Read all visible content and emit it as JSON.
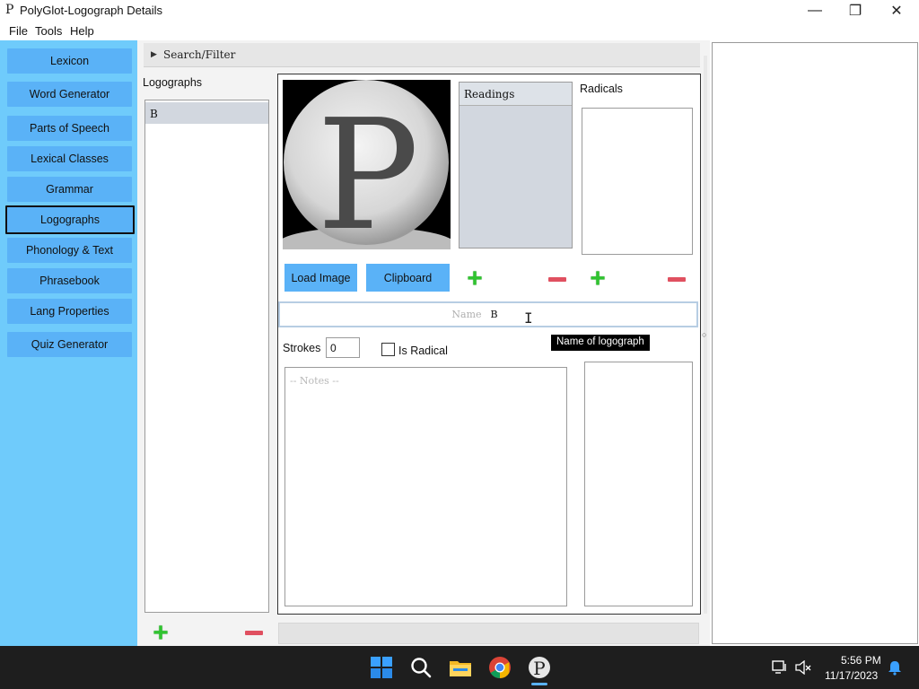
{
  "window": {
    "title": "PolyGlot-Logograph Details",
    "app_icon_glyph": "P",
    "controls": {
      "minimize": "—",
      "maximize": "❐",
      "close": "✕"
    }
  },
  "menu": [
    "File",
    "Tools",
    "Help"
  ],
  "sidebar": {
    "items": [
      {
        "label": "Lexicon"
      },
      {
        "label": "Word Generator"
      },
      {
        "label": "Parts of Speech"
      },
      {
        "label": "Lexical Classes"
      },
      {
        "label": "Grammar"
      },
      {
        "label": "Logographs",
        "active": true
      },
      {
        "label": "Phonology & Text"
      },
      {
        "label": "Phrasebook"
      },
      {
        "label": "Lang Properties"
      },
      {
        "label": "Quiz Generator"
      }
    ]
  },
  "search": {
    "label": "Search/Filter"
  },
  "logographs": {
    "label": "Logographs",
    "items": [
      "B"
    ]
  },
  "details": {
    "image_glyph": "P",
    "readings_header": "Readings",
    "radicals_label": "Radicals",
    "load_image_label": "Load Image",
    "clipboard_label": "Clipboard",
    "name_placeholder": "Name",
    "name_value": "B",
    "tooltip": "Name of logograph",
    "strokes_label": "Strokes",
    "strokes_value": "0",
    "is_radical_label": "Is Radical",
    "notes_placeholder": "-- Notes --"
  },
  "taskbar": {
    "time": "5:56 PM",
    "date": "11/17/2023",
    "icons": [
      "windows-start-icon",
      "search-icon",
      "file-explorer-icon",
      "chrome-icon",
      "polyglot-icon"
    ]
  },
  "colors": {
    "sidebar_bg": "#6fcbfb",
    "button_blue": "#5ab2f7",
    "plus_green": "#2fc42f",
    "minus_red": "#e05060",
    "taskbar_bg": "#1e1e1e"
  }
}
